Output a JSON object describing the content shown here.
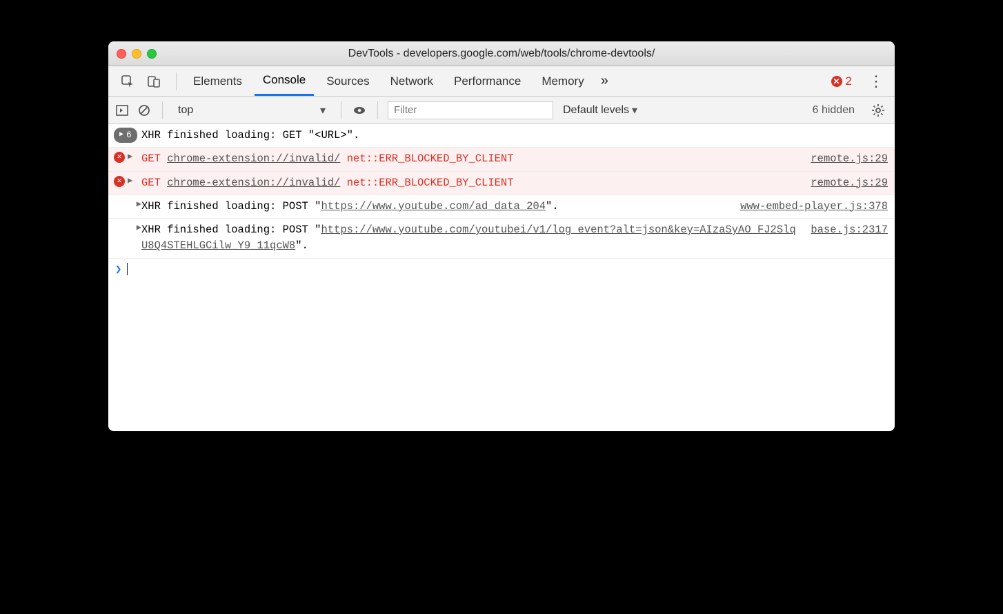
{
  "window": {
    "title": "DevTools - developers.google.com/web/tools/chrome-devtools/"
  },
  "tabs": {
    "items": [
      "Elements",
      "Console",
      "Sources",
      "Network",
      "Performance",
      "Memory"
    ],
    "active_index": 1,
    "overflow": "»",
    "error_count": "2"
  },
  "toolbar": {
    "context": "top",
    "filter_placeholder": "Filter",
    "levels_label": "Default levels",
    "hidden_label": "6 hidden"
  },
  "messages": {
    "m0": {
      "badge_count": "6",
      "text": "XHR finished loading: GET \"<URL>\"."
    },
    "m1": {
      "method": "GET",
      "url": "chrome-extension://invalid/",
      "err": "net::ERR_BLOCKED_BY_CLIENT",
      "src": "remote.js:29"
    },
    "m2": {
      "method": "GET",
      "url": "chrome-extension://invalid/",
      "err": "net::ERR_BLOCKED_BY_CLIENT",
      "src": "remote.js:29"
    },
    "m3": {
      "prefix": "XHR finished loading: POST \"",
      "url": "https://www.youtube.com/ad_data_204",
      "suffix": "\".",
      "src": "www-embed-player.js:378"
    },
    "m4": {
      "prefix": "XHR finished loading: POST \"",
      "url": "https://www.youtube.com/youtubei/v1/log_event?alt=json&key=AIzaSyAO_FJ2SlqU8Q4STEHLGCilw_Y9_11qcW8",
      "suffix": "\".",
      "src": "base.js:2317"
    }
  },
  "prompt": "❯"
}
